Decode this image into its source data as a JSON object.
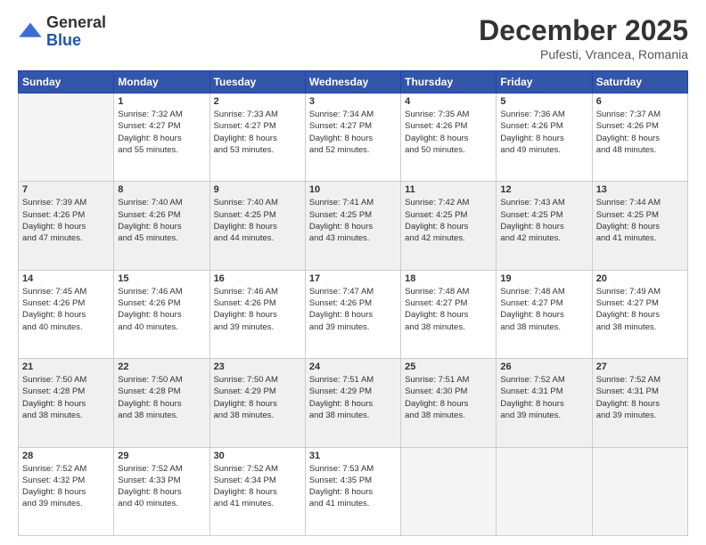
{
  "logo": {
    "general": "General",
    "blue": "Blue"
  },
  "title": "December 2025",
  "subtitle": "Pufesti, Vrancea, Romania",
  "days_of_week": [
    "Sunday",
    "Monday",
    "Tuesday",
    "Wednesday",
    "Thursday",
    "Friday",
    "Saturday"
  ],
  "weeks": [
    [
      {
        "day": "",
        "sunrise": "",
        "sunset": "",
        "daylight": ""
      },
      {
        "day": "1",
        "sunrise": "Sunrise: 7:32 AM",
        "sunset": "Sunset: 4:27 PM",
        "daylight": "Daylight: 8 hours and 55 minutes."
      },
      {
        "day": "2",
        "sunrise": "Sunrise: 7:33 AM",
        "sunset": "Sunset: 4:27 PM",
        "daylight": "Daylight: 8 hours and 53 minutes."
      },
      {
        "day": "3",
        "sunrise": "Sunrise: 7:34 AM",
        "sunset": "Sunset: 4:27 PM",
        "daylight": "Daylight: 8 hours and 52 minutes."
      },
      {
        "day": "4",
        "sunrise": "Sunrise: 7:35 AM",
        "sunset": "Sunset: 4:26 PM",
        "daylight": "Daylight: 8 hours and 50 minutes."
      },
      {
        "day": "5",
        "sunrise": "Sunrise: 7:36 AM",
        "sunset": "Sunset: 4:26 PM",
        "daylight": "Daylight: 8 hours and 49 minutes."
      },
      {
        "day": "6",
        "sunrise": "Sunrise: 7:37 AM",
        "sunset": "Sunset: 4:26 PM",
        "daylight": "Daylight: 8 hours and 48 minutes."
      }
    ],
    [
      {
        "day": "7",
        "sunrise": "Sunrise: 7:39 AM",
        "sunset": "Sunset: 4:26 PM",
        "daylight": "Daylight: 8 hours and 47 minutes."
      },
      {
        "day": "8",
        "sunrise": "Sunrise: 7:40 AM",
        "sunset": "Sunset: 4:26 PM",
        "daylight": "Daylight: 8 hours and 45 minutes."
      },
      {
        "day": "9",
        "sunrise": "Sunrise: 7:40 AM",
        "sunset": "Sunset: 4:25 PM",
        "daylight": "Daylight: 8 hours and 44 minutes."
      },
      {
        "day": "10",
        "sunrise": "Sunrise: 7:41 AM",
        "sunset": "Sunset: 4:25 PM",
        "daylight": "Daylight: 8 hours and 43 minutes."
      },
      {
        "day": "11",
        "sunrise": "Sunrise: 7:42 AM",
        "sunset": "Sunset: 4:25 PM",
        "daylight": "Daylight: 8 hours and 42 minutes."
      },
      {
        "day": "12",
        "sunrise": "Sunrise: 7:43 AM",
        "sunset": "Sunset: 4:25 PM",
        "daylight": "Daylight: 8 hours and 42 minutes."
      },
      {
        "day": "13",
        "sunrise": "Sunrise: 7:44 AM",
        "sunset": "Sunset: 4:25 PM",
        "daylight": "Daylight: 8 hours and 41 minutes."
      }
    ],
    [
      {
        "day": "14",
        "sunrise": "Sunrise: 7:45 AM",
        "sunset": "Sunset: 4:26 PM",
        "daylight": "Daylight: 8 hours and 40 minutes."
      },
      {
        "day": "15",
        "sunrise": "Sunrise: 7:46 AM",
        "sunset": "Sunset: 4:26 PM",
        "daylight": "Daylight: 8 hours and 40 minutes."
      },
      {
        "day": "16",
        "sunrise": "Sunrise: 7:46 AM",
        "sunset": "Sunset: 4:26 PM",
        "daylight": "Daylight: 8 hours and 39 minutes."
      },
      {
        "day": "17",
        "sunrise": "Sunrise: 7:47 AM",
        "sunset": "Sunset: 4:26 PM",
        "daylight": "Daylight: 8 hours and 39 minutes."
      },
      {
        "day": "18",
        "sunrise": "Sunrise: 7:48 AM",
        "sunset": "Sunset: 4:27 PM",
        "daylight": "Daylight: 8 hours and 38 minutes."
      },
      {
        "day": "19",
        "sunrise": "Sunrise: 7:48 AM",
        "sunset": "Sunset: 4:27 PM",
        "daylight": "Daylight: 8 hours and 38 minutes."
      },
      {
        "day": "20",
        "sunrise": "Sunrise: 7:49 AM",
        "sunset": "Sunset: 4:27 PM",
        "daylight": "Daylight: 8 hours and 38 minutes."
      }
    ],
    [
      {
        "day": "21",
        "sunrise": "Sunrise: 7:50 AM",
        "sunset": "Sunset: 4:28 PM",
        "daylight": "Daylight: 8 hours and 38 minutes."
      },
      {
        "day": "22",
        "sunrise": "Sunrise: 7:50 AM",
        "sunset": "Sunset: 4:28 PM",
        "daylight": "Daylight: 8 hours and 38 minutes."
      },
      {
        "day": "23",
        "sunrise": "Sunrise: 7:50 AM",
        "sunset": "Sunset: 4:29 PM",
        "daylight": "Daylight: 8 hours and 38 minutes."
      },
      {
        "day": "24",
        "sunrise": "Sunrise: 7:51 AM",
        "sunset": "Sunset: 4:29 PM",
        "daylight": "Daylight: 8 hours and 38 minutes."
      },
      {
        "day": "25",
        "sunrise": "Sunrise: 7:51 AM",
        "sunset": "Sunset: 4:30 PM",
        "daylight": "Daylight: 8 hours and 38 minutes."
      },
      {
        "day": "26",
        "sunrise": "Sunrise: 7:52 AM",
        "sunset": "Sunset: 4:31 PM",
        "daylight": "Daylight: 8 hours and 39 minutes."
      },
      {
        "day": "27",
        "sunrise": "Sunrise: 7:52 AM",
        "sunset": "Sunset: 4:31 PM",
        "daylight": "Daylight: 8 hours and 39 minutes."
      }
    ],
    [
      {
        "day": "28",
        "sunrise": "Sunrise: 7:52 AM",
        "sunset": "Sunset: 4:32 PM",
        "daylight": "Daylight: 8 hours and 39 minutes."
      },
      {
        "day": "29",
        "sunrise": "Sunrise: 7:52 AM",
        "sunset": "Sunset: 4:33 PM",
        "daylight": "Daylight: 8 hours and 40 minutes."
      },
      {
        "day": "30",
        "sunrise": "Sunrise: 7:52 AM",
        "sunset": "Sunset: 4:34 PM",
        "daylight": "Daylight: 8 hours and 41 minutes."
      },
      {
        "day": "31",
        "sunrise": "Sunrise: 7:53 AM",
        "sunset": "Sunset: 4:35 PM",
        "daylight": "Daylight: 8 hours and 41 minutes."
      },
      {
        "day": "",
        "sunrise": "",
        "sunset": "",
        "daylight": ""
      },
      {
        "day": "",
        "sunrise": "",
        "sunset": "",
        "daylight": ""
      },
      {
        "day": "",
        "sunrise": "",
        "sunset": "",
        "daylight": ""
      }
    ]
  ]
}
